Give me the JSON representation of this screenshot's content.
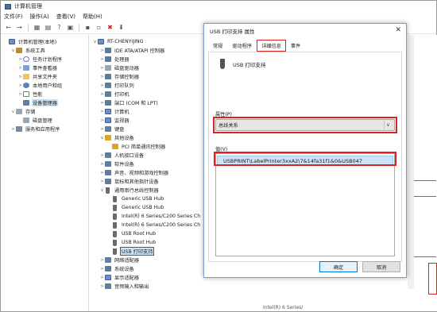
{
  "window": {
    "title": "计算机管理",
    "menu": [
      "文件(F)",
      "操作(A)",
      "查看(V)",
      "帮助(H)"
    ]
  },
  "left_tree": [
    {
      "label": "计算机管理(本地)",
      "indent": 0,
      "exp": "",
      "icon": "pc",
      "name": "tree-computer-management-local",
      "sel": false
    },
    {
      "label": "系统工具",
      "indent": 1,
      "exp": "∨",
      "icon": "tool",
      "name": "tree-system-tools",
      "sel": false
    },
    {
      "label": "任务计划程序",
      "indent": 2,
      "exp": ">",
      "icon": "clock",
      "name": "tree-task-scheduler",
      "sel": false
    },
    {
      "label": "事件查看器",
      "indent": 2,
      "exp": ">",
      "icon": "book",
      "name": "tree-event-viewer",
      "sel": false
    },
    {
      "label": "共享文件夹",
      "indent": 2,
      "exp": ">",
      "icon": "folder",
      "name": "tree-shared-folders",
      "sel": false
    },
    {
      "label": "本地用户和组",
      "indent": 2,
      "exp": ">",
      "icon": "users",
      "name": "tree-local-users",
      "sel": false
    },
    {
      "label": "性能",
      "indent": 2,
      "exp": ">",
      "icon": "perf",
      "name": "tree-performance",
      "sel": false
    },
    {
      "label": "设备管理器",
      "indent": 2,
      "exp": "",
      "icon": "dev",
      "name": "tree-device-manager",
      "sel": true
    },
    {
      "label": "存储",
      "indent": 1,
      "exp": "∨",
      "icon": "disk",
      "name": "tree-storage",
      "sel": false
    },
    {
      "label": "磁盘管理",
      "indent": 2,
      "exp": "",
      "icon": "disk",
      "name": "tree-disk-management",
      "sel": false
    },
    {
      "label": "服务和应用程序",
      "indent": 1,
      "exp": ">",
      "icon": "svc",
      "name": "tree-services-apps",
      "sel": false
    }
  ],
  "device_tree": [
    {
      "label": "RT-CHENYIJING",
      "indent": 0,
      "exp": "∨",
      "icon": "pc"
    },
    {
      "label": "IDE ATA/ATAPI 控制器",
      "indent": 1,
      "exp": ">",
      "icon": "chip"
    },
    {
      "label": "处理器",
      "indent": 1,
      "exp": ">",
      "icon": "chip"
    },
    {
      "label": "磁盘驱动器",
      "indent": 1,
      "exp": ">",
      "icon": "disk"
    },
    {
      "label": "存储控制器",
      "indent": 1,
      "exp": ">",
      "icon": "chip"
    },
    {
      "label": "打印队列",
      "indent": 1,
      "exp": ">",
      "icon": "dev"
    },
    {
      "label": "打印机",
      "indent": 1,
      "exp": ">",
      "icon": "dev"
    },
    {
      "label": "端口 (COM 和 LPT)",
      "indent": 1,
      "exp": ">",
      "icon": "chip"
    },
    {
      "label": "计算机",
      "indent": 1,
      "exp": ">",
      "icon": "pc"
    },
    {
      "label": "监视器",
      "indent": 1,
      "exp": ">",
      "icon": "pc"
    },
    {
      "label": "键盘",
      "indent": 1,
      "exp": ">",
      "icon": "dev"
    },
    {
      "label": "其他设备",
      "indent": 1,
      "exp": "∨",
      "icon": "warn"
    },
    {
      "label": "PCI 简单通讯控制器",
      "indent": 2,
      "exp": "",
      "icon": "warn"
    },
    {
      "label": "人机接口设备",
      "indent": 1,
      "exp": ">",
      "icon": "dev"
    },
    {
      "label": "软件设备",
      "indent": 1,
      "exp": ">",
      "icon": "dev"
    },
    {
      "label": "声音、视频和游戏控制器",
      "indent": 1,
      "exp": ">",
      "icon": "dev"
    },
    {
      "label": "鼠标和其他指针设备",
      "indent": 1,
      "exp": ">",
      "icon": "dev"
    },
    {
      "label": "通用串行总线控制器",
      "indent": 1,
      "exp": "∨",
      "icon": "usb"
    },
    {
      "label": "Generic USB Hub",
      "indent": 2,
      "exp": "",
      "icon": "usb"
    },
    {
      "label": "Generic USB Hub",
      "indent": 2,
      "exp": "",
      "icon": "usb"
    },
    {
      "label": "Intel(R) 6 Series/C200 Series Ch",
      "indent": 2,
      "exp": "",
      "icon": "usb"
    },
    {
      "label": "Intel(R) 6 Series/C200 Series Ch",
      "indent": 2,
      "exp": "",
      "icon": "usb"
    },
    {
      "label": "USB Root Hub",
      "indent": 2,
      "exp": "",
      "icon": "usb"
    },
    {
      "label": "USB Root Hub",
      "indent": 2,
      "exp": "",
      "icon": "usb"
    },
    {
      "label": "USB 打印支持",
      "indent": 2,
      "exp": "",
      "icon": "usb",
      "highlight": true
    },
    {
      "label": "网络适配器",
      "indent": 1,
      "exp": ">",
      "icon": "dev"
    },
    {
      "label": "系统设备",
      "indent": 1,
      "exp": ">",
      "icon": "chip"
    },
    {
      "label": "显示适配器",
      "indent": 1,
      "exp": ">",
      "icon": "pc"
    },
    {
      "label": "音频输入和输出",
      "indent": 1,
      "exp": ">",
      "icon": "dev"
    }
  ],
  "dialog": {
    "title": "USB 打印支持 属性",
    "tabs": [
      "常规",
      "驱动程序",
      "详细信息",
      "事件"
    ],
    "active_tab": 2,
    "device_name": "USB 打印支持",
    "property_label": "属性(P)",
    "property_value": "总线关系",
    "value_label": "值(V)",
    "value_item": "USBPRINT\\LabelPrinter3xxA2\\7&14fa31f1&0&USB047",
    "ok": "确定",
    "cancel": "取消"
  },
  "background_peek": {
    "bottom_text": "Intel(R) 6 Series/"
  },
  "colors": {
    "highlight_red": "#e0201f",
    "selection_blue": "#cce4f7"
  }
}
